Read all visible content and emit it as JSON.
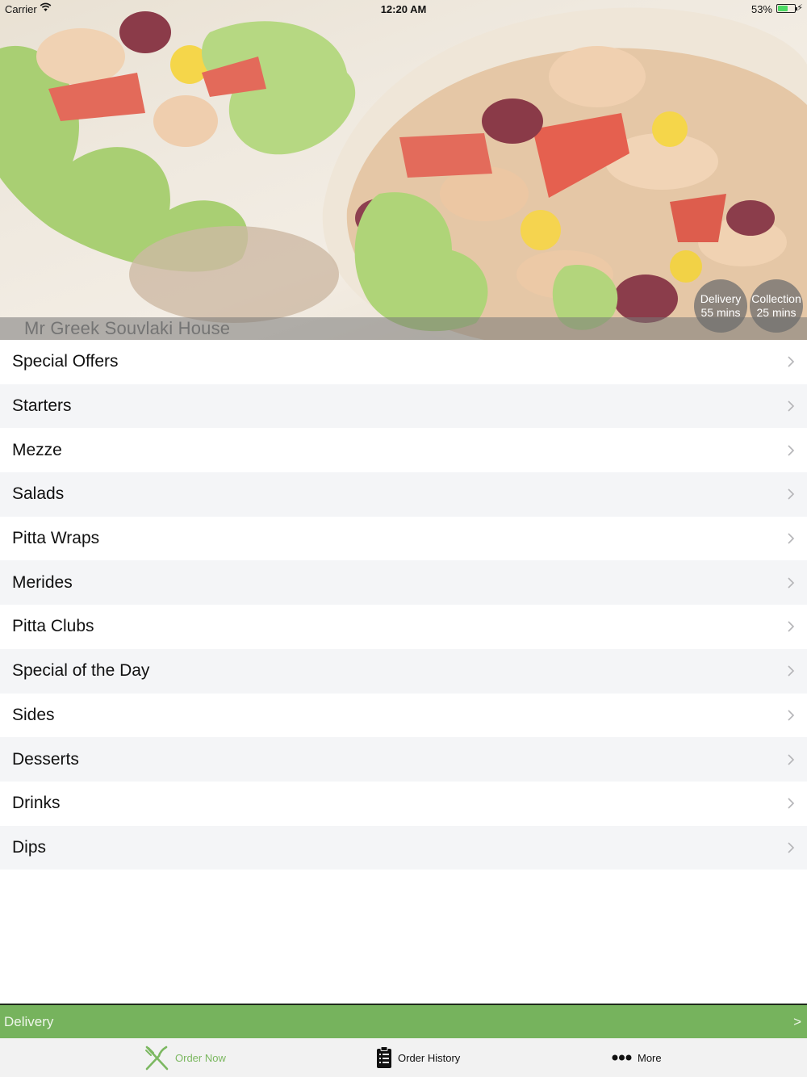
{
  "status_bar": {
    "carrier": "Carrier",
    "time": "12:20 AM",
    "battery": "53%",
    "battery_level": 0.53
  },
  "restaurant": {
    "name": "Mr Greek Souvlaki House"
  },
  "times": {
    "delivery_label": "Delivery",
    "delivery_time": "55 mins",
    "collection_label": "Collection",
    "collection_time": "25 mins"
  },
  "menu": {
    "categories": [
      "Special Offers",
      "Starters",
      "Mezze",
      "Salads",
      "Pitta Wraps",
      "Merides",
      "Pitta Clubs",
      "Special of the Day",
      "Sides",
      "Desserts",
      "Drinks",
      "Dips"
    ],
    "chevron_icon": "chevron-right-icon"
  },
  "order_bar": {
    "mode": "Delivery",
    "arrow": ">"
  },
  "tabs": {
    "order_now": "Order Now",
    "order_history": "Order History",
    "more": "More"
  },
  "colors": {
    "accent": "#76b35d",
    "tab_active": "#7cb861",
    "row_alt": "#f4f5f7"
  }
}
